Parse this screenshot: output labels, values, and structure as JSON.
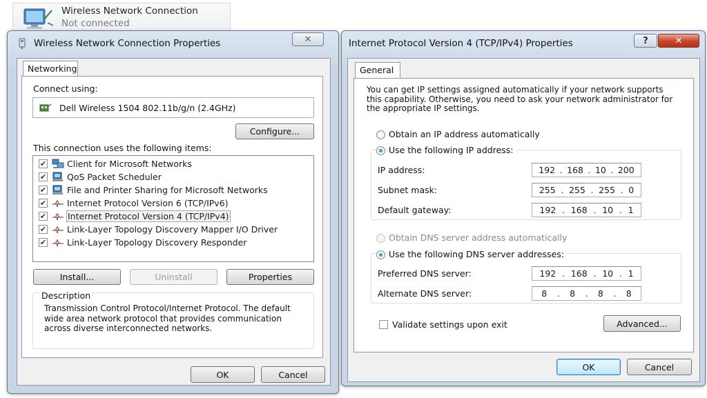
{
  "connection_tile": {
    "name": "Wireless Network Connection",
    "status": "Not connected",
    "icon": "wireless-network-icon"
  },
  "left_window": {
    "title": "Wireless Network Connection Properties",
    "close_glyph": "✕",
    "tab": "Networking",
    "connect_using_label": "Connect using:",
    "adapter": "Dell Wireless 1504 802.11b/g/n (2.4GHz)",
    "configure_button": "Configure...",
    "items_label": "This connection uses the following items:",
    "items": [
      {
        "label": "Client for Microsoft Networks",
        "checked": true,
        "icon": "network-client-icon"
      },
      {
        "label": "QoS Packet Scheduler",
        "checked": true,
        "icon": "network-service-icon"
      },
      {
        "label": "File and Printer Sharing for Microsoft Networks",
        "checked": true,
        "icon": "network-service-icon"
      },
      {
        "label": "Internet Protocol Version 6 (TCP/IPv6)",
        "checked": true,
        "icon": "protocol-icon"
      },
      {
        "label": "Internet Protocol Version 4 (TCP/IPv4)",
        "checked": true,
        "icon": "protocol-icon",
        "selected": true
      },
      {
        "label": "Link-Layer Topology Discovery Mapper I/O Driver",
        "checked": true,
        "icon": "protocol-icon"
      },
      {
        "label": "Link-Layer Topology Discovery Responder",
        "checked": true,
        "icon": "protocol-icon"
      }
    ],
    "install_button": "Install...",
    "uninstall_button": "Uninstall",
    "properties_button": "Properties",
    "description_label": "Description",
    "description_text": "Transmission Control Protocol/Internet Protocol. The default wide area network protocol that provides communication across diverse interconnected networks.",
    "ok_button": "OK",
    "cancel_button": "Cancel"
  },
  "right_window": {
    "title": "Internet Protocol Version 4 (TCP/IPv4) Properties",
    "help_glyph": "?",
    "close_glyph": "✕",
    "tab": "General",
    "intro_text": "You can get IP settings assigned automatically if your network supports this capability. Otherwise, you need to ask your network administrator for the appropriate IP settings.",
    "obtain_ip_auto": "Obtain an IP address automatically",
    "use_following_ip": "Use the following IP address:",
    "ip_mode": "manual",
    "ip_address_label": "IP address:",
    "ip_address": [
      "192",
      "168",
      "10",
      "200"
    ],
    "subnet_mask_label": "Subnet mask:",
    "subnet_mask": [
      "255",
      "255",
      "255",
      "0"
    ],
    "default_gateway_label": "Default gateway:",
    "default_gateway": [
      "192",
      "168",
      "10",
      "1"
    ],
    "obtain_dns_auto": "Obtain DNS server address automatically",
    "use_following_dns": "Use the following DNS server addresses:",
    "dns_mode": "manual",
    "preferred_dns_label": "Preferred DNS server:",
    "preferred_dns": [
      "192",
      "168",
      "10",
      "1"
    ],
    "alternate_dns_label": "Alternate DNS server:",
    "alternate_dns": [
      "8",
      "8",
      "8",
      "8"
    ],
    "validate_label": "Validate settings upon exit",
    "validate_checked": false,
    "advanced_button": "Advanced...",
    "ok_button": "OK",
    "cancel_button": "Cancel"
  }
}
